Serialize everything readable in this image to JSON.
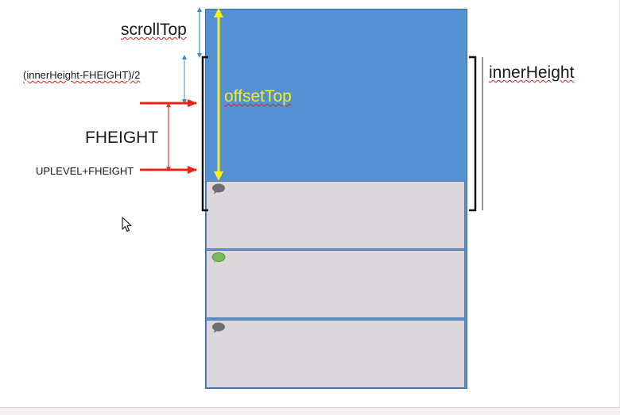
{
  "labels": {
    "scroll_top": "scrollTop",
    "half_gap": "(innerHeight-FHEIGHT)/2",
    "fheight": "FHEIGHT",
    "uplevel": "UPLEVEL+FHEIGHT",
    "offset_top": "offsetTop",
    "inner_height": "innerHeight"
  },
  "messages": [
    {
      "bubble": "speech-bubble-icon",
      "color": "#6f6f73"
    },
    {
      "bubble": "speech-bubble-icon",
      "color": "#7fb85a"
    },
    {
      "bubble": "speech-bubble-icon",
      "color": "#6f6f73"
    }
  ],
  "colors": {
    "column": "#5590d2",
    "message_bg": "#dcd7da",
    "offset_arrow": "#f2ef1c",
    "red_arrow": "#e8231a",
    "guide_arrow": "#3a8fc8",
    "fheight_arrow": "#c8463a"
  }
}
